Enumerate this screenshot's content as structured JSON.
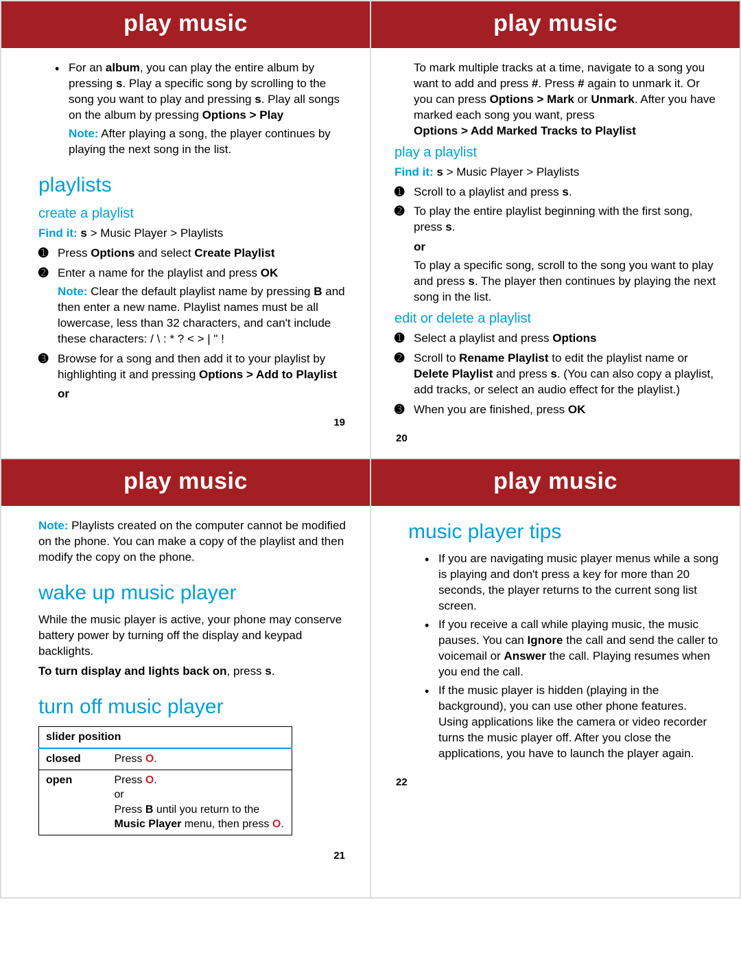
{
  "banner": "play music",
  "p19": {
    "bullet1_a": "For an ",
    "bullet1_album": "album",
    "bullet1_b": ", you can play the entire album by pressing ",
    "bullet1_c": ". Play a specific song by scrolling to the song you want to play and pressing ",
    "bullet1_d": ". Play all songs on the album by pressing ",
    "bullet1_opts": "Options > Play",
    "note_lbl": "Note:",
    "note_txt": " After playing a song, the player continues by playing the next song in the list.",
    "h_playlists": "playlists",
    "h_create": "create a playlist",
    "find_lbl": "Find it:",
    "find_path": "   > Music Player > Playlists",
    "step1_a": "Press ",
    "step1_opts": "Options",
    "step1_b": " and select ",
    "step1_create": "Create Playlist",
    "step2_a": "Enter a name for the playlist and press ",
    "step2_ok": "OK",
    "note2_lbl": "Note:",
    "note2_a": " Clear the default playlist name by pressing ",
    "note2_b": " and then enter a new name. Playlist names must be all lowercase, less than 32 characters, and can't include these characters: / \\ : * ? < > | \" !",
    "step3_a": "Browse for a song and then add it to your playlist by highlighting it and pressing ",
    "step3_opts": "Options > Add to Playlist",
    "or": "or",
    "num": "19"
  },
  "p20": {
    "intro_a": "To mark multiple tracks at a time, navigate to a song you want to add and press ",
    "hash": "#",
    "intro_b": ". Press ",
    "intro_c": " again to unmark it. Or you can press ",
    "opts_mark": "Options > Mark",
    "intro_d": " or ",
    "unmark": "Unmark",
    "intro_e": ". After you have marked each song you want, press ",
    "opts_add": "Options > Add Marked Tracks to Playlist",
    "h_playplaylist": "play a playlist",
    "find_lbl": "Find it:",
    "find_path": "   > Music Player > Playlists",
    "step1": "Scroll to a playlist and press ",
    "step2_a": "To play the entire playlist beginning with the first song, press ",
    "or": "or",
    "step2_b": "To play a specific song, scroll to the song you want to play and press ",
    "step2_c": ". The player then continues by playing the next song in the list.",
    "h_edit": "edit or delete a playlist",
    "e1_a": "Select a playlist and press ",
    "e1_opts": "Options",
    "e2_a": "Scroll to ",
    "e2_rename": "Rename Playlist",
    "e2_b": " to edit the playlist name or ",
    "e2_delete": "Delete Playlist",
    "e2_c": " and press ",
    "e2_d": ". (You can also copy a playlist, add tracks, or select an audio effect for the playlist.)",
    "e3_a": "When you are finished, press ",
    "e3_ok": "OK",
    "num": "20"
  },
  "p21": {
    "note_lbl": "Note:",
    "note_txt": " Playlists created on the computer cannot be modified on the phone. You can make a copy of the playlist and then modify the copy on the phone.",
    "h_wake": "wake up music player",
    "wake_p": "While the music player is active, your phone may conserve battery power by turning off the display and keypad backlights.",
    "wake_bold": "To turn display and lights back on",
    "wake_tail": ", press ",
    "h_off": "turn off music player",
    "tbl_head": "slider position",
    "row1_c1": "closed",
    "row1_c2a": "Press ",
    "row2_c1": "open",
    "row2_c2a": "Press ",
    "row2_or": "or",
    "row2_c2b": "Press ",
    "row2_c2c": " until you return to the ",
    "row2_mp": "Music Player",
    "row2_c2d": " menu, then press ",
    "num": "21"
  },
  "p22": {
    "h_tips": "music player tips",
    "b1": "If you are navigating music player menus while a song is playing and don't press a key for more than 20 seconds, the player returns to the current song list screen.",
    "b2_a": "If you receive a call while playing music, the music pauses. You can ",
    "b2_ignore": "Ignore",
    "b2_b": " the call and send the caller to voicemail or ",
    "b2_answer": "Answer",
    "b2_c": " the call. Playing resumes when you end the call.",
    "b3": "If the music player is hidden (playing in the background), you can use other phone features. Using applications like the camera or video recorder turns the music player off. After you close the applications, you have to launch the player again.",
    "num": "22"
  },
  "glyphs": {
    "s": "s",
    "b": "B",
    "o": "O",
    "gt": ">"
  }
}
